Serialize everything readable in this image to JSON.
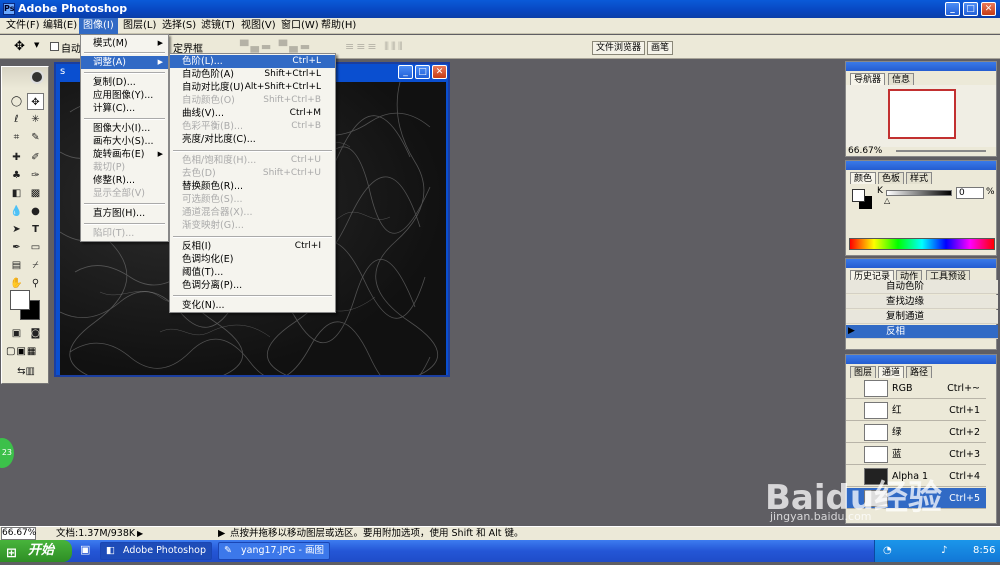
{
  "app": {
    "title": "Adobe Photoshop"
  },
  "menubar": [
    "文件(F)",
    "编辑(E)",
    "图像(I)",
    "图层(L)",
    "选择(S)",
    "滤镜(T)",
    "视图(V)",
    "窗口(W)",
    "帮助(H)"
  ],
  "options": {
    "auto_label": "自动",
    "bbox_label": "定界框",
    "file_browser": "文件浏览器",
    "brushes": "画笔"
  },
  "document": {
    "title_fragment": "s"
  },
  "image_menu": [
    {
      "label": "模式(M)",
      "submenu": true
    },
    {
      "label": "调整(A)",
      "submenu": true,
      "selected": true
    },
    {
      "label": "复制(D)..."
    },
    {
      "label": "应用图像(Y)..."
    },
    {
      "label": "计算(C)..."
    },
    {
      "label": "图像大小(I)..."
    },
    {
      "label": "画布大小(S)..."
    },
    {
      "label": "旋转画布(E)",
      "submenu": true
    },
    {
      "label": "裁切(P)",
      "disabled": true
    },
    {
      "label": "修整(R)..."
    },
    {
      "label": "显示全部(V)",
      "disabled": true
    },
    {
      "label": "直方图(H)..."
    },
    {
      "label": "陷印(T)...",
      "disabled": true
    }
  ],
  "adjust_menu": [
    {
      "label": "色阶(L)...",
      "shortcut": "Ctrl+L",
      "highlighted": true
    },
    {
      "label": "自动色阶(A)",
      "shortcut": "Shift+Ctrl+L"
    },
    {
      "label": "自动对比度(U)",
      "shortcut": "Alt+Shift+Ctrl+L"
    },
    {
      "label": "自动颜色(O)",
      "shortcut": "Shift+Ctrl+B",
      "disabled": true
    },
    {
      "label": "曲线(V)...",
      "shortcut": "Ctrl+M"
    },
    {
      "label": "色彩平衡(B)...",
      "shortcut": "Ctrl+B",
      "disabled": true
    },
    {
      "label": "亮度/对比度(C)..."
    },
    {
      "label": "色相/饱和度(H)...",
      "shortcut": "Ctrl+U",
      "disabled": true
    },
    {
      "label": "去色(D)",
      "shortcut": "Shift+Ctrl+U",
      "disabled": true
    },
    {
      "label": "替换颜色(R)..."
    },
    {
      "label": "可选颜色(S)...",
      "disabled": true
    },
    {
      "label": "通道混合器(X)...",
      "disabled": true
    },
    {
      "label": "渐变映射(G)...",
      "disabled": true
    },
    {
      "label": "反相(I)",
      "shortcut": "Ctrl+I"
    },
    {
      "label": "色调均化(E)"
    },
    {
      "label": "阈值(T)..."
    },
    {
      "label": "色调分离(P)..."
    },
    {
      "label": "变化(N)..."
    }
  ],
  "navigator": {
    "tabs": [
      "导航器",
      "信息"
    ],
    "zoom": "66.67%"
  },
  "color_panel": {
    "tabs": [
      "颜色",
      "色板",
      "样式"
    ],
    "channel": "K",
    "value": "0",
    "unit": "%"
  },
  "history": {
    "tabs": [
      "历史记录",
      "动作",
      "工具预设"
    ],
    "items": [
      "自动色阶",
      "查找边缘",
      "复制通道",
      "反相"
    ],
    "selected": "反相"
  },
  "channels": {
    "tabs": [
      "图层",
      "通道",
      "路径"
    ],
    "items": [
      {
        "name": "RGB",
        "shortcut": "Ctrl+~"
      },
      {
        "name": "红",
        "shortcut": "Ctrl+1"
      },
      {
        "name": "绿",
        "shortcut": "Ctrl+2"
      },
      {
        "name": "蓝",
        "shortcut": "Ctrl+3"
      },
      {
        "name": "Alpha 1",
        "shortcut": "Ctrl+4"
      },
      {
        "name": "",
        "shortcut": "Ctrl+5"
      }
    ]
  },
  "status": {
    "zoom": "66.67%",
    "doc_info": "文档:1.37M/938K",
    "hint": "点按并拖移以移动图层或选区。要用附加选项，使用 Shift 和 Alt 键。"
  },
  "taskbar": {
    "start": "开始",
    "tasks": [
      "Adobe Photoshop",
      "yang17.JPG - 画图"
    ],
    "time": "8:56"
  },
  "watermark": {
    "brand": "Baidu经验",
    "url": "jingyan.baidu.com"
  },
  "badge": "23"
}
